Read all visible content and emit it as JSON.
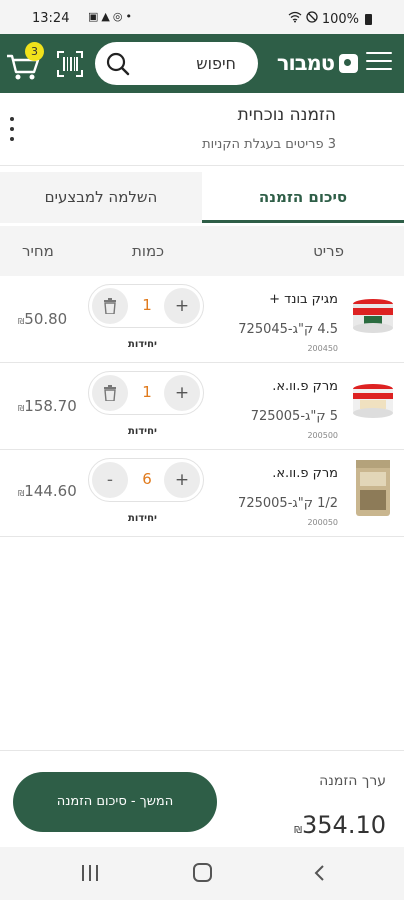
{
  "status_bar": {
    "time": "13:24",
    "icons": [
      "image-icon",
      "warning-icon",
      "target-icon",
      "dot"
    ],
    "battery": "100%"
  },
  "header": {
    "logo_text": "טמבור",
    "search_placeholder": "חיפוש",
    "cart_count": "3",
    "brand_color": "#2e5e47",
    "badge_color": "#f1e21b"
  },
  "order": {
    "title": "הזמנה נוכחית",
    "subtitle": "3 פריטים בעגלת הקניות"
  },
  "tabs": [
    {
      "label": "סיכום הזמנה",
      "active": true
    },
    {
      "label": "השלמה למבצעים",
      "active": false
    }
  ],
  "table": {
    "headers": {
      "item": "פריט",
      "qty": "כמות",
      "price": "מחיר"
    },
    "rows": [
      {
        "name": "מגיק בונד +",
        "sku": "4.5  ק\"ג-725045",
        "code": "200450",
        "qty": "1",
        "unit": "יחידות",
        "price": "50.80",
        "currency": "₪",
        "left_action": "trash"
      },
      {
        "name": "מרק פ.וו.א.",
        "sku": "5 ק\"ג-725005",
        "code": "200500",
        "qty": "1",
        "unit": "יחידות",
        "price": "158.70",
        "currency": "₪",
        "left_action": "trash"
      },
      {
        "name": "מרק פ.וו.א.",
        "sku": "1/2 ק\"ג-725005",
        "code": "200050",
        "qty": "6",
        "unit": "יחידות",
        "price": "144.60",
        "currency": "₪",
        "left_action": "minus"
      }
    ]
  },
  "footer": {
    "label": "ערך הזמנה",
    "total": "354.10",
    "currency": "₪",
    "cta": "המשך - סיכום הזמנה"
  }
}
